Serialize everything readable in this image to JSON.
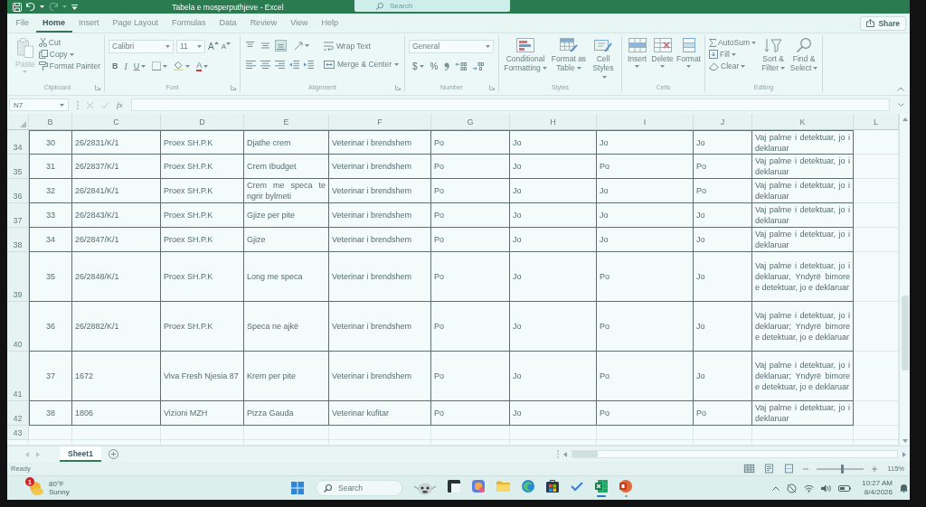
{
  "window": {
    "title": "Tabela e mosperputhjeve - Excel",
    "redo_disabled": true,
    "search": {
      "placeholder": "Search"
    },
    "share": "Share"
  },
  "ribbon": {
    "tabs": [
      {
        "label": "File",
        "selected": false
      },
      {
        "label": "Home",
        "selected": true
      },
      {
        "label": "Insert",
        "selected": false
      },
      {
        "label": "Page Layout",
        "selected": false
      },
      {
        "label": "Formulas",
        "selected": false
      },
      {
        "label": "Data",
        "selected": false
      },
      {
        "label": "Review",
        "selected": false
      },
      {
        "label": "View",
        "selected": false
      },
      {
        "label": "Help",
        "selected": false
      }
    ],
    "clipboard": {
      "name": "Clipboard",
      "paste": {
        "label": "Paste",
        "disabled": true
      },
      "cut": "Cut",
      "copy": "Copy",
      "format_painter": "Format Painter"
    },
    "font": {
      "name": "Font",
      "font_name": "Calibri",
      "font_size": "11",
      "grow": "A",
      "shrink": "A",
      "bold": "B",
      "italic": "I",
      "underline": "U",
      "font_color": "A"
    },
    "alignment": {
      "name": "Alignment",
      "vertical": [
        {
          "kind": "top",
          "selected": false
        },
        {
          "kind": "middle",
          "selected": false
        },
        {
          "kind": "bottom",
          "selected": true
        }
      ],
      "wrap_text": "Wrap Text",
      "merge_center": "Merge & Center"
    },
    "number": {
      "name": "Number",
      "format": "General",
      "currency": "$",
      "percent": "%"
    },
    "styles": {
      "name": "Styles",
      "buttons": [
        {
          "kind": "conditional",
          "label": "Conditional Formatting"
        },
        {
          "kind": "table",
          "label": "Format as Table"
        },
        {
          "kind": "cell_styles",
          "label": "Cell Styles"
        }
      ]
    },
    "cells": {
      "name": "Cells",
      "buttons": [
        {
          "kind": "insert",
          "label": "Insert"
        },
        {
          "kind": "delete",
          "label": "Delete"
        },
        {
          "kind": "format",
          "label": "Format"
        }
      ]
    },
    "editing": {
      "name": "Editing",
      "autosum": "AutoSum",
      "fill": "Fill",
      "clear": "Clear",
      "sort_filter": "Sort & Filter",
      "find_select": "Find & Select"
    }
  },
  "formula_bar": {
    "name_box": "N7",
    "function": "fx"
  },
  "sheet": {
    "columns": [
      "B",
      "C",
      "D",
      "E",
      "F",
      "G",
      "H",
      "I",
      "J",
      "K",
      "L"
    ],
    "rows": [
      {
        "number": "34",
        "cells": [
          "30",
          "26/2831/K/1",
          "Proex SH.P.K",
          "Djathe crem",
          "Veterinar i brendshem",
          "Po",
          "Jo",
          "Jo",
          "Jo",
          "Vaj palme i detektuar, jo i deklaruar"
        ]
      },
      {
        "number": "35",
        "cells": [
          "31",
          "26/2837/K/1",
          "Proex SH.P.K",
          "Crem Ibudget",
          "Veterinar i brendshem",
          "Po",
          "Jo",
          "Po",
          "Po",
          "Vaj palme i detektuar, jo i deklaruar"
        ]
      },
      {
        "number": "36",
        "cells": [
          "32",
          "26/2841/K/1",
          "Proex SH.P.K",
          "Crem me speca te ngrir bylmeti",
          "Veterinar i brendshem",
          "Po",
          "Jo",
          "Jo",
          "Po",
          "Vaj palme i detektuar, jo i deklaruar"
        ]
      },
      {
        "number": "37",
        "cells": [
          "33",
          "26/2843/K/1",
          "Proex SH.P.K",
          "Gjize per pite",
          "Veterinar i brendshem",
          "Po",
          "Jo",
          "Jo",
          "Jo",
          "Vaj palme i detektuar, jo i deklaruar"
        ]
      },
      {
        "number": "38",
        "cells": [
          "34",
          "26/2847/K/1",
          "Proex SH.P.K",
          "Gjize",
          "Veterinar i brendshem",
          "Po",
          "Jo",
          "Jo",
          "Jo",
          "Vaj palme i detektuar, jo i deklaruar"
        ]
      },
      {
        "number": "39",
        "cells": [
          "35",
          "26/2848/K/1",
          "Proex SH.P.K",
          "Long me speca",
          "Veterinar i brendshem",
          "Po",
          "Jo",
          "Po",
          "Jo",
          "Vaj palme i detektuar, jo i deklaruar, Yndyrë bimore e detektuar, jo e deklaruar"
        ]
      },
      {
        "number": "40",
        "cells": [
          "36",
          "26/2882/K/1",
          "Proex SH.P.K",
          "Speca ne ajkë",
          "Veterinar i brendshem",
          "Po",
          "Jo",
          "Po",
          "Jo",
          "Vaj palme i detektuar, jo i deklaruar; Yndyrë bimore e detektuar, jo e deklaruar"
        ]
      },
      {
        "number": "41",
        "cells": [
          "37",
          "1672",
          "Viva Fresh Njesia 87",
          "Krem per pite",
          "Veterinar i brendshem",
          "Po",
          "Jo",
          "Po",
          "Jo",
          "Vaj palme i detektuar, jo i deklaruar; Yndyrë bimore e detektuar, jo e deklaruar"
        ]
      },
      {
        "number": "42",
        "cells": [
          "38",
          "1806",
          "Vizioni MZH",
          "Pizza Gauda",
          "Veterinar kufitar",
          "Po",
          "Jo",
          "Po",
          "Po",
          "Vaj palme i detektuar, jo i deklaruar"
        ]
      },
      {
        "number": "43"
      }
    ]
  },
  "sheet_tabs": [
    {
      "label": "Sheet1",
      "selected": true
    }
  ],
  "status_bar": {
    "text": "Ready",
    "views": [
      {
        "kind": "normal",
        "selected": true
      },
      {
        "kind": "page_layout",
        "selected": false
      },
      {
        "kind": "page_break",
        "selected": false
      }
    ],
    "zoom": {
      "level": 0.54,
      "reading": "115%"
    }
  },
  "taskbar": {
    "weather": {
      "badge": "1",
      "temperature": "80°F",
      "condition": "Sunny"
    },
    "search": {
      "placeholder": "Search"
    },
    "apps": [
      {
        "kind": "task_view",
        "running": false,
        "active": false
      },
      {
        "kind": "assistant",
        "running": false,
        "active": false
      },
      {
        "kind": "files",
        "running": false,
        "active": false
      },
      {
        "kind": "browser",
        "running": false,
        "active": false
      },
      {
        "kind": "store",
        "running": false,
        "active": false
      },
      {
        "kind": "todo",
        "running": false,
        "active": false
      },
      {
        "kind": "spreadsheet",
        "running": true,
        "active": true
      },
      {
        "kind": "presentation",
        "running": true,
        "active": false
      }
    ],
    "clock": {
      "time": "10:27 AM",
      "date": "8/4/2026"
    }
  }
}
